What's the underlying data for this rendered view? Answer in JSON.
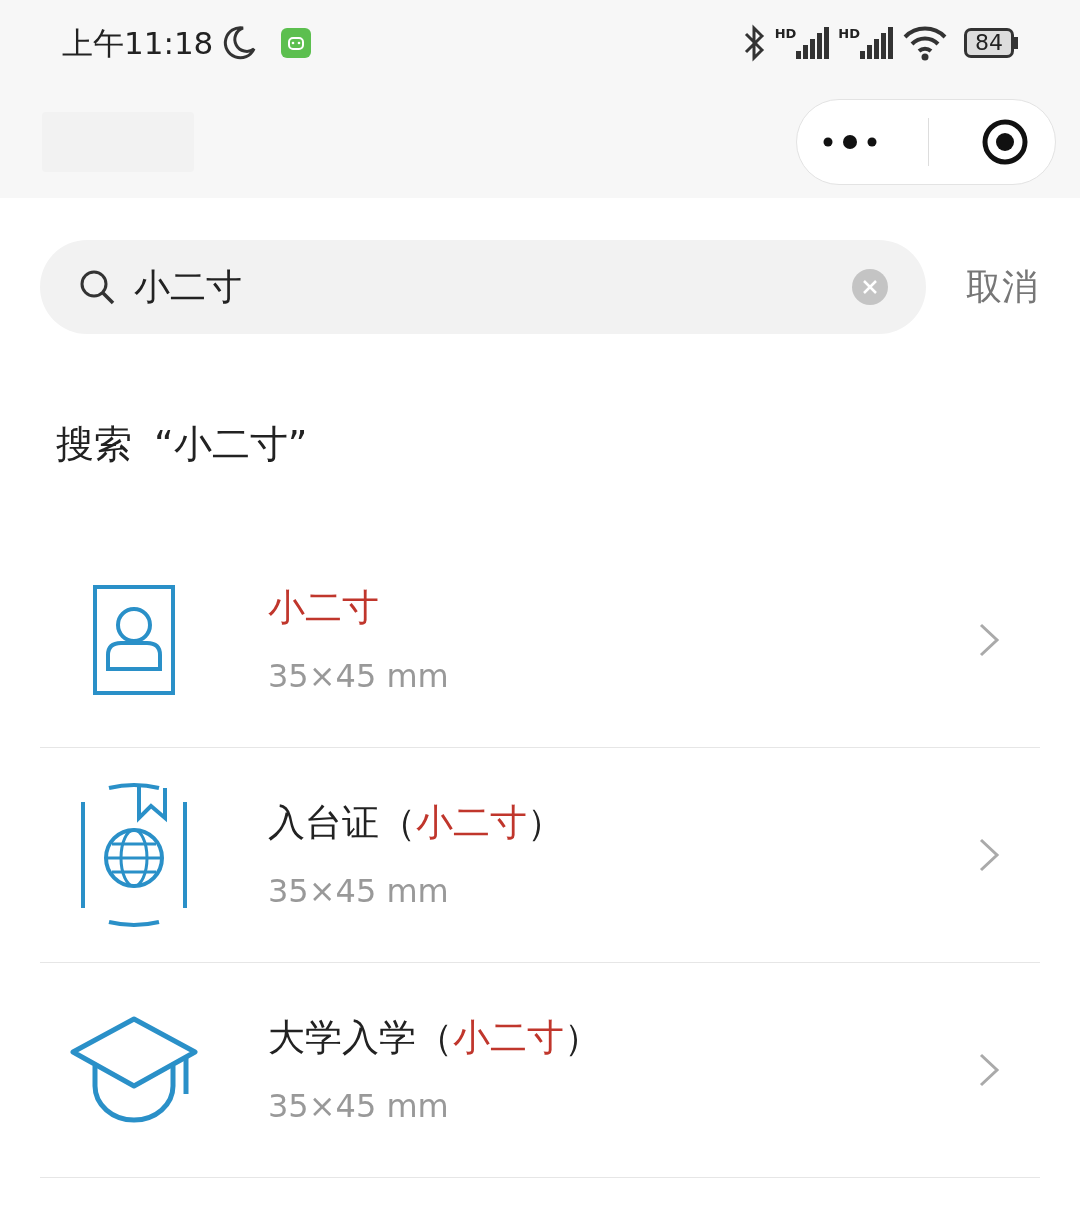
{
  "status_bar": {
    "time": "上午11:18",
    "battery": "84",
    "signal_labels": [
      "HD",
      "HD"
    ]
  },
  "search": {
    "value": "小二寸",
    "cancel": "取消"
  },
  "search_hint": {
    "prefix": "搜索",
    "query": "“小二寸”"
  },
  "results": [
    {
      "kind": "id-photo",
      "title": [
        {
          "text": "小二寸",
          "highlight": true
        }
      ],
      "size": "35×45 mm"
    },
    {
      "kind": "passport",
      "title": [
        {
          "text": "入台证（",
          "highlight": false
        },
        {
          "text": "小二寸",
          "highlight": true
        },
        {
          "text": "）",
          "highlight": false
        }
      ],
      "size": "35×45 mm"
    },
    {
      "kind": "graduation-cap",
      "title": [
        {
          "text": "大学入学（",
          "highlight": false
        },
        {
          "text": "小二寸",
          "highlight": true
        },
        {
          "text": "）",
          "highlight": false
        }
      ],
      "size": "35×45 mm"
    }
  ]
}
